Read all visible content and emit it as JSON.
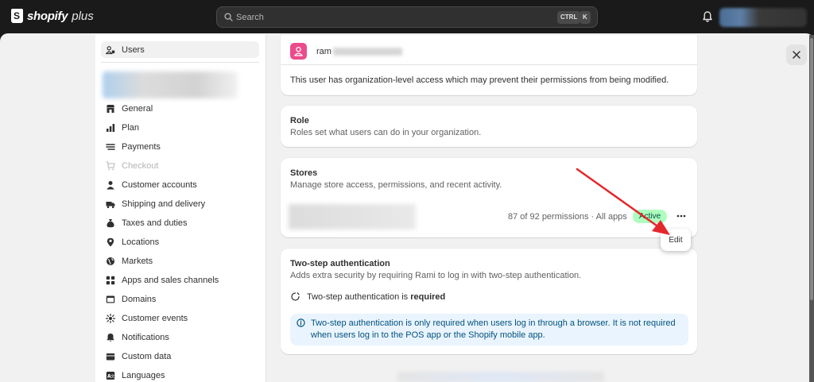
{
  "topbar": {
    "brand": "shopify",
    "brand_plus": "plus",
    "search_placeholder": "Search",
    "shortcut_ctrl": "CTRL",
    "shortcut_k": "K"
  },
  "sidebar": {
    "active_item": {
      "label": "Users",
      "icon": "users-icon"
    },
    "items": [
      {
        "label": "General",
        "icon": "store-icon",
        "disabled": false
      },
      {
        "label": "Plan",
        "icon": "plan-icon",
        "disabled": false
      },
      {
        "label": "Payments",
        "icon": "payments-icon",
        "disabled": false
      },
      {
        "label": "Checkout",
        "icon": "cart-icon",
        "disabled": true
      },
      {
        "label": "Customer accounts",
        "icon": "person-icon",
        "disabled": false
      },
      {
        "label": "Shipping and delivery",
        "icon": "truck-icon",
        "disabled": false
      },
      {
        "label": "Taxes and duties",
        "icon": "tax-icon",
        "disabled": false
      },
      {
        "label": "Locations",
        "icon": "location-icon",
        "disabled": false
      },
      {
        "label": "Markets",
        "icon": "globe-icon",
        "disabled": false
      },
      {
        "label": "Apps and sales channels",
        "icon": "apps-icon",
        "disabled": false
      },
      {
        "label": "Domains",
        "icon": "domain-icon",
        "disabled": false
      },
      {
        "label": "Customer events",
        "icon": "events-icon",
        "disabled": false
      },
      {
        "label": "Notifications",
        "icon": "bell-icon",
        "disabled": false
      },
      {
        "label": "Custom data",
        "icon": "database-icon",
        "disabled": false
      },
      {
        "label": "Languages",
        "icon": "language-icon",
        "disabled": false
      }
    ]
  },
  "user_card": {
    "name": "ram",
    "note": "This user has organization-level access which may prevent their permissions from being modified."
  },
  "role_card": {
    "title": "Role",
    "subtitle": "Roles set what users can do in your organization."
  },
  "stores_card": {
    "title": "Stores",
    "subtitle": "Manage store access, permissions, and recent activity.",
    "permissions": "87 of 92 permissions · All apps",
    "status": "Active",
    "menu_edit": "Edit"
  },
  "twostep_card": {
    "title": "Two-step authentication",
    "subtitle": "Adds extra security by requiring Rami to log in with two-step authentication.",
    "requirement_prefix": "Two-step authentication is ",
    "requirement_value": "required",
    "info": "Two-step authentication is only required when users log in through a browser. It is not required when users log in to the POS app or the Shopify mobile app."
  },
  "colors": {
    "topbar": "#1a1a1a",
    "avatar": "#ec4b8b",
    "active_badge": "#affebf",
    "info_bg": "#eaf4ff",
    "arrow": "#e3282c"
  }
}
